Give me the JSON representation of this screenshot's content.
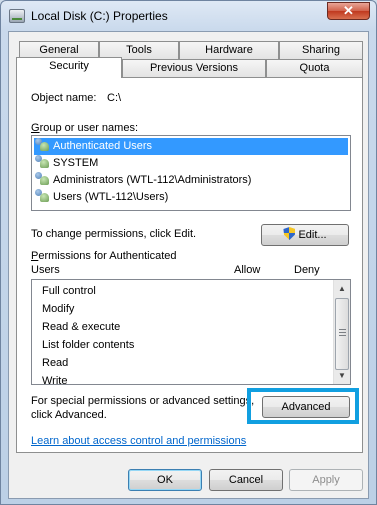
{
  "window": {
    "title": "Local Disk (C:) Properties",
    "close_label": "✕"
  },
  "tabs": {
    "row_top": [
      "General",
      "Tools",
      "Hardware",
      "Sharing"
    ],
    "row_bottom": [
      "Security",
      "Previous Versions",
      "Quota"
    ],
    "selected": "Security"
  },
  "security": {
    "object_name_label": "Object name:",
    "object_name_value": "C:\\",
    "group_label": "Group or user names:",
    "groups": [
      "Authenticated Users",
      "SYSTEM",
      "Administrators (WTL-112\\Administrators)",
      "Users (WTL-112\\Users)"
    ],
    "selected_group": "Authenticated Users",
    "change_hint": "To change permissions, click Edit.",
    "edit_button": "Edit...",
    "permissions_label_line1": "Permissions for Authenticated",
    "permissions_label_line2": "Users",
    "allow_header": "Allow",
    "deny_header": "Deny",
    "permissions": [
      "Full control",
      "Modify",
      "Read & execute",
      "List folder contents",
      "Read",
      "Write"
    ],
    "special_hint_line1": "For special permissions or advanced settings,",
    "special_hint_line2": "click Advanced.",
    "advanced_button": "Advanced",
    "learn_link": "Learn about access control and permissions"
  },
  "footer": {
    "ok_button": "OK",
    "cancel_button": "Cancel",
    "apply_button": "Apply"
  },
  "colors": {
    "selection": "#3399ff",
    "highlight_box": "#119fe0",
    "link": "#0066cc"
  }
}
